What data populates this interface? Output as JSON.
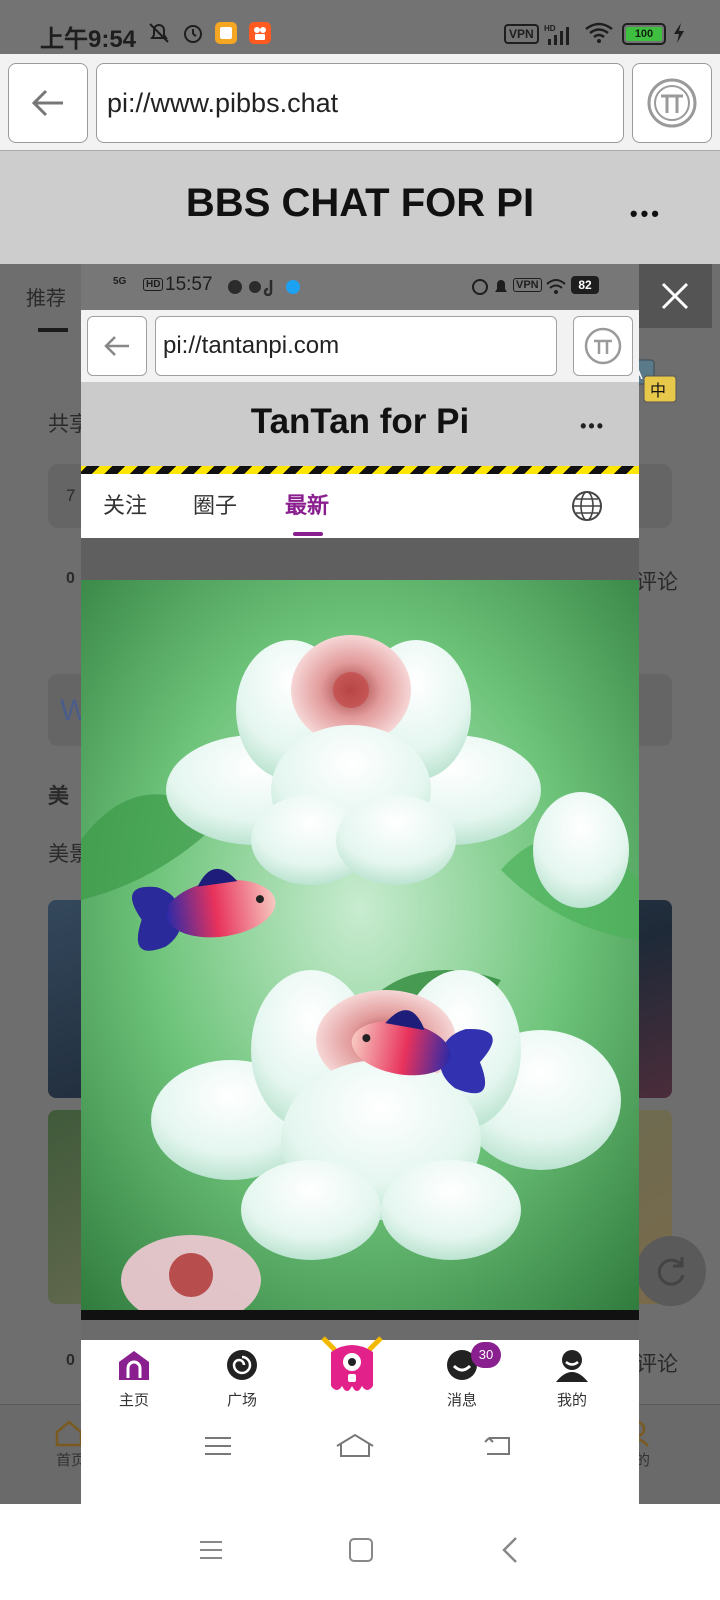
{
  "status_bar": {
    "time": "上午9:54",
    "vpn": "VPN",
    "network": "HD",
    "battery": "100"
  },
  "browser": {
    "url": "pi://www.pibbs.chat"
  },
  "app": {
    "title": "BBS CHAT FOR PI",
    "more": "•••"
  },
  "background_page": {
    "tab_recommend": "推荐",
    "text_share": "共享",
    "card_num": "7",
    "zero_1": "0",
    "comment_1": "评论",
    "w_letter": "W",
    "heading_mei": "美",
    "text_mei": "美景",
    "zero_2": "0",
    "comment_2": "评论",
    "nav": {
      "home": "首页",
      "mine": "我的"
    }
  },
  "modal": {
    "status_bar": {
      "time": "15:57",
      "network": "5G",
      "hd": "HD",
      "vpn": "VPN",
      "battery": "82"
    },
    "browser": {
      "url": "pi://tantanpi.com"
    },
    "app": {
      "title": "TanTan for Pi",
      "more": "•••"
    },
    "tabs": [
      {
        "label": "关注",
        "active": false
      },
      {
        "label": "圈子",
        "active": false
      },
      {
        "label": "最新",
        "active": true
      }
    ],
    "image_description_icon": "lotus-goldfish-artwork",
    "bottom_nav": [
      {
        "label": "主页",
        "icon": "home-icon"
      },
      {
        "label": "广场",
        "icon": "swirl-icon"
      },
      {
        "label": "",
        "icon": "mascot-icon"
      },
      {
        "label": "消息",
        "icon": "message-icon",
        "badge": "30"
      },
      {
        "label": "我的",
        "icon": "profile-icon"
      }
    ]
  },
  "colors": {
    "accent": "#8a1f8f",
    "header_bg": "#cdcdcd",
    "overlay": "#6e6e6e"
  }
}
